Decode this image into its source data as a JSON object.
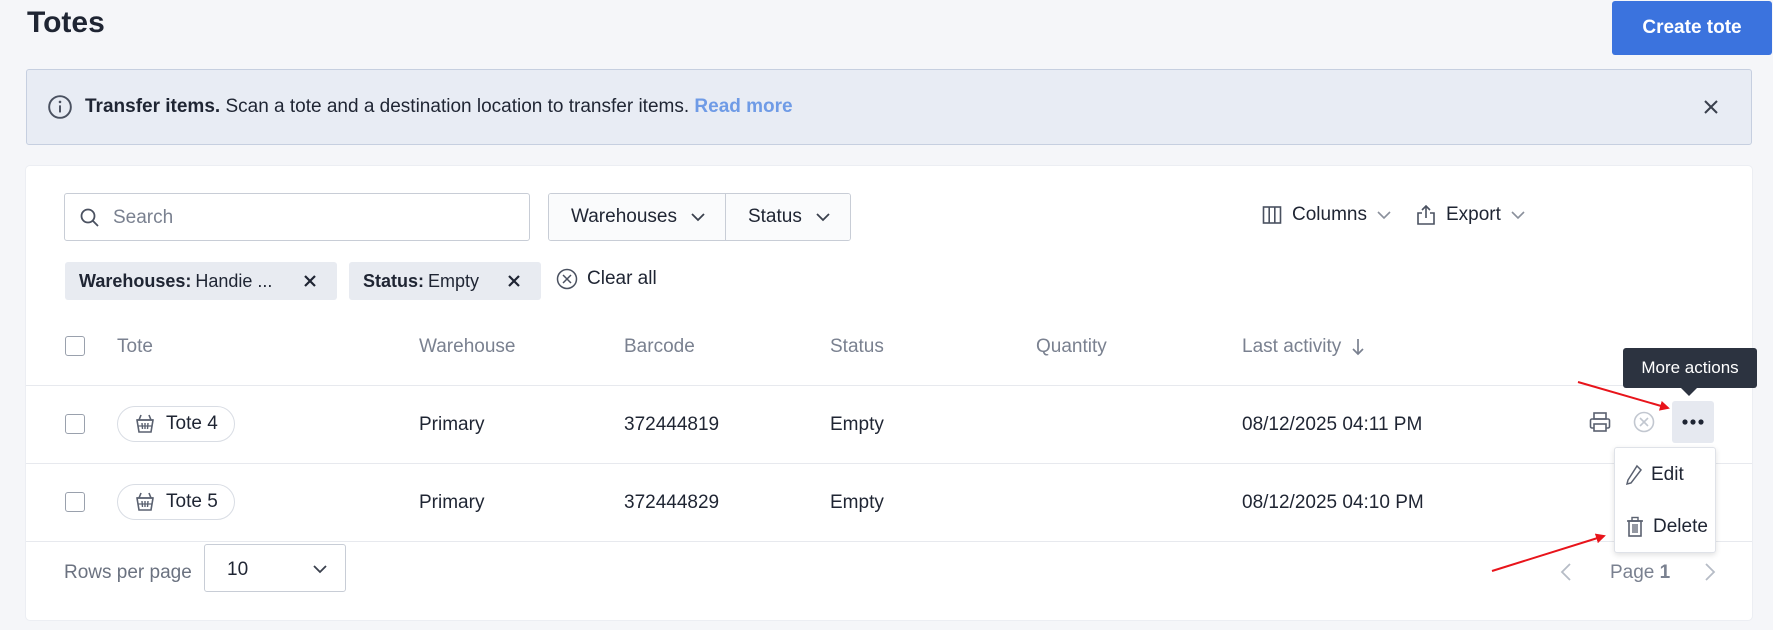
{
  "page": {
    "title": "Totes",
    "create_button": "Create tote"
  },
  "banner": {
    "title": "Transfer items.",
    "message": " Scan a tote and a destination location to transfer items. ",
    "link": "Read more",
    "icon": "info-icon",
    "close_icon": "close-icon"
  },
  "toolbar": {
    "search_placeholder": "Search",
    "filters": [
      "Warehouses",
      "Status"
    ],
    "columns_label": "Columns",
    "export_label": "Export"
  },
  "chips": [
    {
      "key": "Warehouses:",
      "value": "Handie ..."
    },
    {
      "key": "Status:",
      "value": "Empty"
    }
  ],
  "clear_all": "Clear all",
  "table": {
    "headers": [
      "Tote",
      "Warehouse",
      "Barcode",
      "Status",
      "Quantity",
      "Last activity"
    ],
    "rows": [
      {
        "tote": "Tote 4",
        "warehouse": "Primary",
        "barcode": "372444819",
        "status": "Empty",
        "quantity": "",
        "last_activity": "08/12/2025 04:11 PM"
      },
      {
        "tote": "Tote 5",
        "warehouse": "Primary",
        "barcode": "372444829",
        "status": "Empty",
        "quantity": "",
        "last_activity": "08/12/2025 04:10 PM"
      }
    ]
  },
  "tooltip": "More actions",
  "menu": {
    "edit": "Edit",
    "delete": "Delete"
  },
  "footer": {
    "rows_per_page_label": "Rows per page",
    "rows_per_page_value": "10",
    "page_label": "Page",
    "page_number": "1"
  },
  "colors": {
    "primary": "#3b73de",
    "link": "#6f9be6",
    "annotation_arrow": "#e8141b",
    "tooltip_bg": "#2c3340"
  }
}
